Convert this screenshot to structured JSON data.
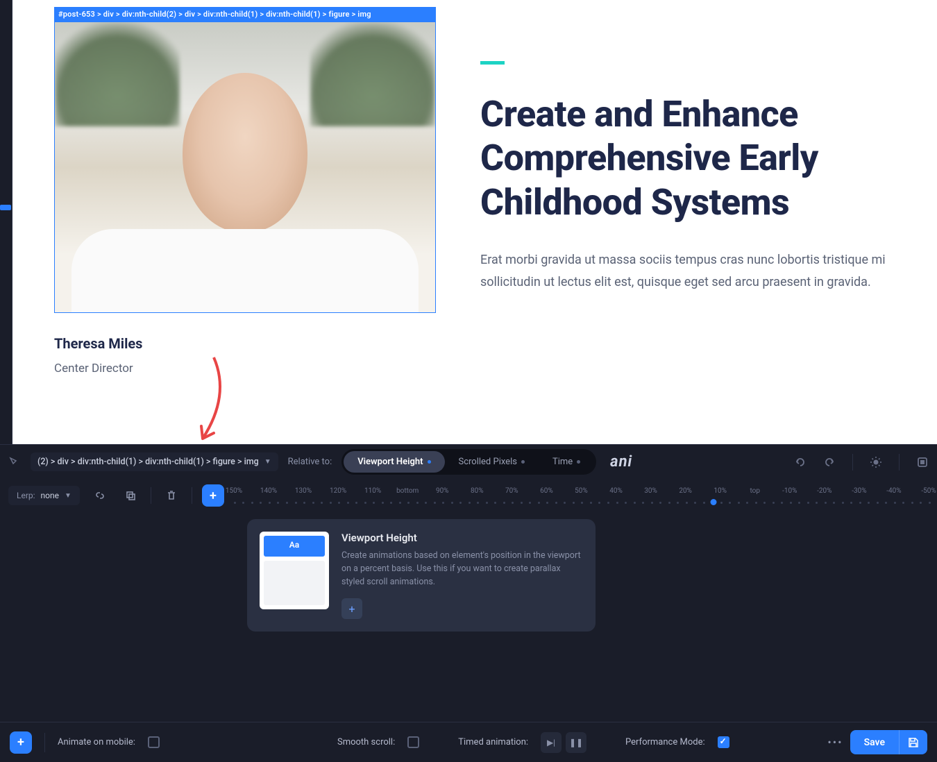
{
  "canvas": {
    "selector_badge": "#post-653 > div > div:nth-child(2) > div > div:nth-child(1) > div:nth-child(1) > figure > img",
    "profile_name": "Theresa Miles",
    "profile_role": "Center Director",
    "headline": "Create and Enhance Comprehensive Early Childhood Systems",
    "body": "Erat morbi gravida ut massa sociis tempus cras nunc lobortis tristique mi sollicitudin ut lectus elit est, quisque eget sed arcu praesent in gravida."
  },
  "selector_bar": {
    "selector_text": "(2) > div > div:nth-child(1) > div:nth-child(1) > figure > img",
    "relative_label": "Relative to:",
    "tabs": [
      {
        "label": "Viewport Height",
        "active": true,
        "dot": true
      },
      {
        "label": "Scrolled Pixels",
        "active": false,
        "dot": true
      },
      {
        "label": "Time",
        "active": false,
        "dot": true
      }
    ],
    "logo": "ani"
  },
  "timeline": {
    "lerp_label": "Lerp:",
    "lerp_value": "none",
    "ruler_ticks": [
      "150%",
      "140%",
      "130%",
      "120%",
      "110%",
      "bottom",
      "90%",
      "80%",
      "70%",
      "60%",
      "50%",
      "40%",
      "30%",
      "20%",
      "10%",
      "top",
      "-10%",
      "-20%",
      "-30%",
      "-40%",
      "-50%"
    ]
  },
  "info_card": {
    "preview_text": "Aa",
    "title": "Viewport Height",
    "description": "Create animations based on element's position in the viewport on a percent basis. Use this if you want to create parallax styled scroll animations."
  },
  "bottom_bar": {
    "animate_mobile_label": "Animate on mobile:",
    "smooth_scroll_label": "Smooth scroll:",
    "timed_animation_label": "Timed animation:",
    "performance_label": "Performance Mode:",
    "save_label": "Save"
  }
}
